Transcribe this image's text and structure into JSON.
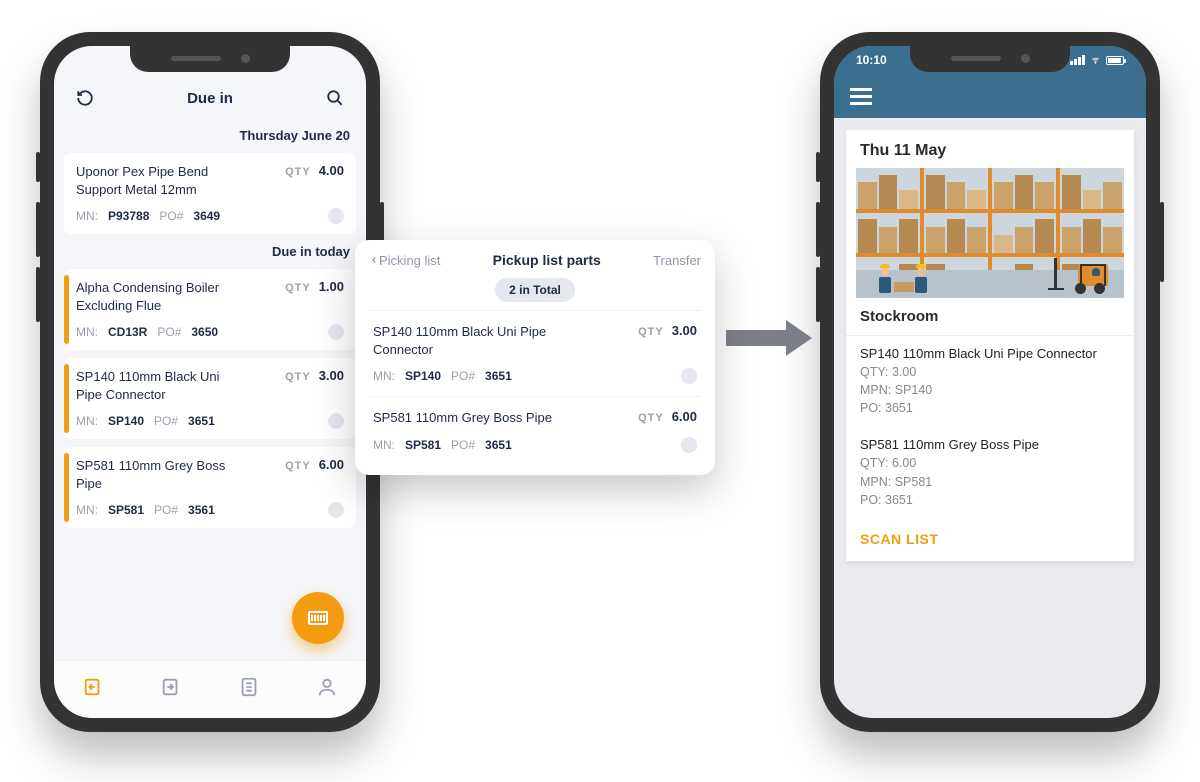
{
  "colors": {
    "accent": "#f39c12",
    "navy": "#1f2a44",
    "tealHeader": "#3c6e8f"
  },
  "leftPhone": {
    "header": {
      "title": "Due in"
    },
    "section1": "Thursday June 20",
    "section2": "Due in today",
    "items": [
      {
        "name": "Uponor Pex Pipe Bend Support Metal 12mm",
        "qtyLabel": "QTY",
        "qty": "4.00",
        "mnLabel": "MN:",
        "mn": "P93788",
        "poLabel": "PO#",
        "po": "3649",
        "highlight": false
      },
      {
        "name": "Alpha Condensing Boiler Excluding Flue",
        "qtyLabel": "QTY",
        "qty": "1.00",
        "mnLabel": "MN:",
        "mn": "CD13R",
        "poLabel": "PO#",
        "po": "3650",
        "highlight": true
      },
      {
        "name": "SP140 110mm Black Uni Pipe Connector",
        "qtyLabel": "QTY",
        "qty": "3.00",
        "mnLabel": "MN:",
        "mn": "SP140",
        "poLabel": "PO#",
        "po": "3651",
        "highlight": true
      },
      {
        "name": "SP581 110mm Grey Boss Pipe",
        "qtyLabel": "QTY",
        "qty": "6.00",
        "mnLabel": "MN:",
        "mn": "SP581",
        "poLabel": "PO#",
        "po": "3561",
        "highlight": true
      }
    ]
  },
  "popup": {
    "back": "Picking list",
    "title": "Pickup list parts",
    "action": "Transfer",
    "totalPill": "2 in Total",
    "items": [
      {
        "name": "SP140 110mm Black Uni Pipe Connector",
        "qtyLabel": "QTY",
        "qty": "3.00",
        "mnLabel": "MN:",
        "mn": "SP140",
        "poLabel": "PO#",
        "po": "3651"
      },
      {
        "name": "SP581 110mm Grey Boss Pipe",
        "qtyLabel": "QTY",
        "qty": "6.00",
        "mnLabel": "MN:",
        "mn": "SP581",
        "poLabel": "PO#",
        "po": "3651"
      }
    ]
  },
  "rightPhone": {
    "statusTime": "10:10",
    "date": "Thu 11 May",
    "sectionTitle": "Stockroom",
    "items": [
      {
        "name": "SP140 110mm Black Uni Pipe Connector",
        "qty": "QTY: 3.00",
        "mpn": "MPN: SP140",
        "po": "PO: 3651"
      },
      {
        "name": "SP581 110mm Grey Boss Pipe",
        "qty": "QTY: 6.00",
        "mpn": "MPN: SP581",
        "po": "PO: 3651"
      }
    ],
    "scanLabel": "SCAN LIST"
  }
}
